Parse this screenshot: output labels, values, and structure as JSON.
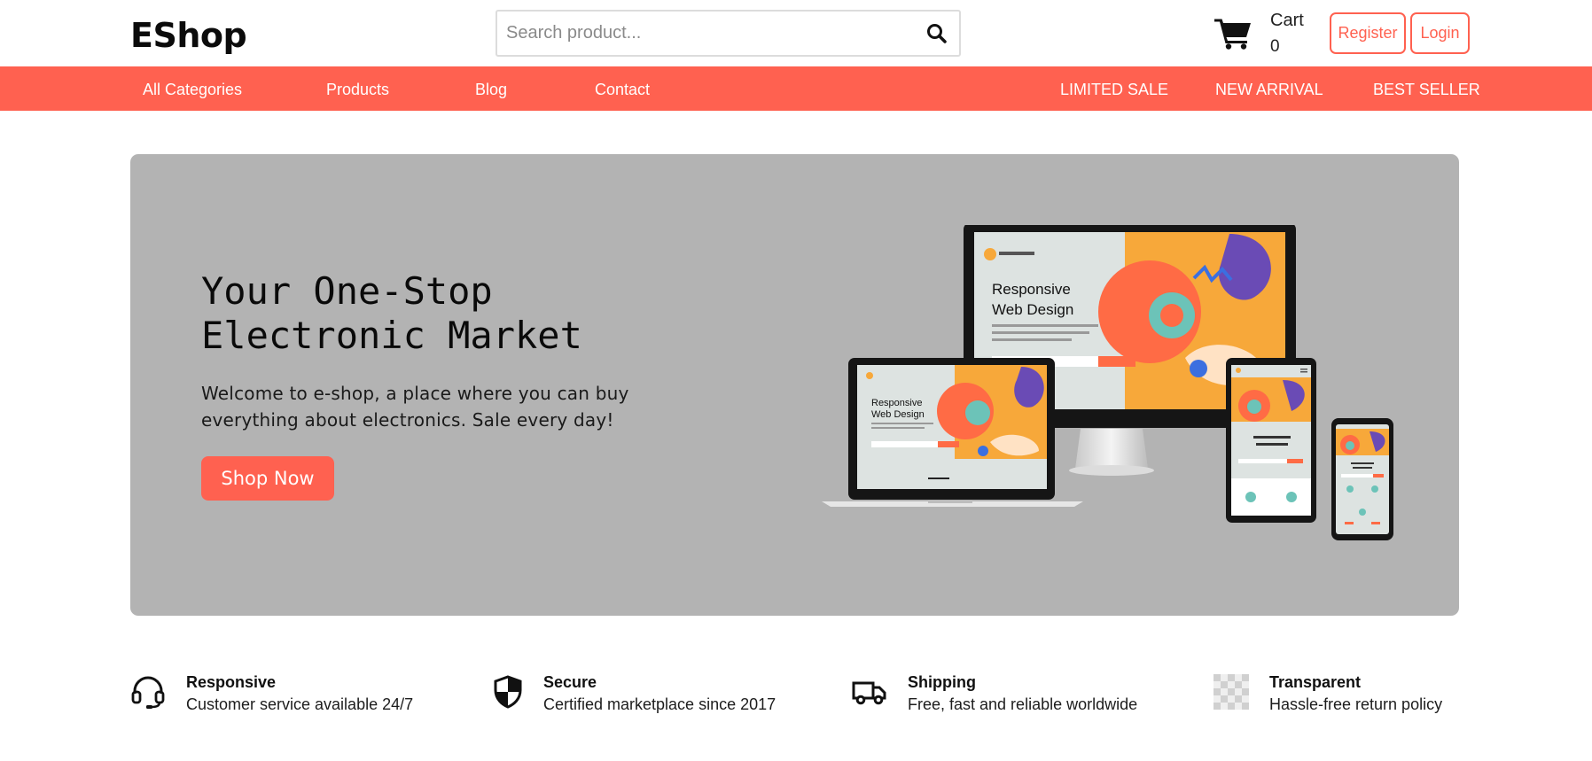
{
  "header": {
    "brand": "EShop",
    "search_placeholder": "Search product...",
    "cart_label": "Cart",
    "cart_count": "0",
    "register_label": "Register",
    "login_label": "Login"
  },
  "nav": {
    "left": [
      "All Categories",
      "Products",
      "Blog",
      "Contact"
    ],
    "right": [
      "LIMITED SALE",
      "NEW ARRIVAL",
      "BEST SELLER"
    ]
  },
  "hero": {
    "title_line1": "Your One-Stop",
    "title_line2": "Electronic Market",
    "desc_line1": "Welcome to e-shop, a place where you can buy",
    "desc_line2": "everything about electronics. Sale every day!",
    "cta_label": "Shop Now",
    "mockup_heading_line1": "Responsive",
    "mockup_heading_line2": "Web Design"
  },
  "features": [
    {
      "icon": "headset-icon",
      "title": "Responsive",
      "desc": "Customer service available 24/7"
    },
    {
      "icon": "shield-icon",
      "title": "Secure",
      "desc": "Certified marketplace since 2017"
    },
    {
      "icon": "truck-icon",
      "title": "Shipping",
      "desc": "Free, fast and reliable worldwide"
    },
    {
      "icon": "checker-icon",
      "title": "Transparent",
      "desc": "Hassle-free return policy"
    }
  ],
  "colors": {
    "accent": "#ff6150",
    "hero_bg": "#b3b3b3"
  }
}
